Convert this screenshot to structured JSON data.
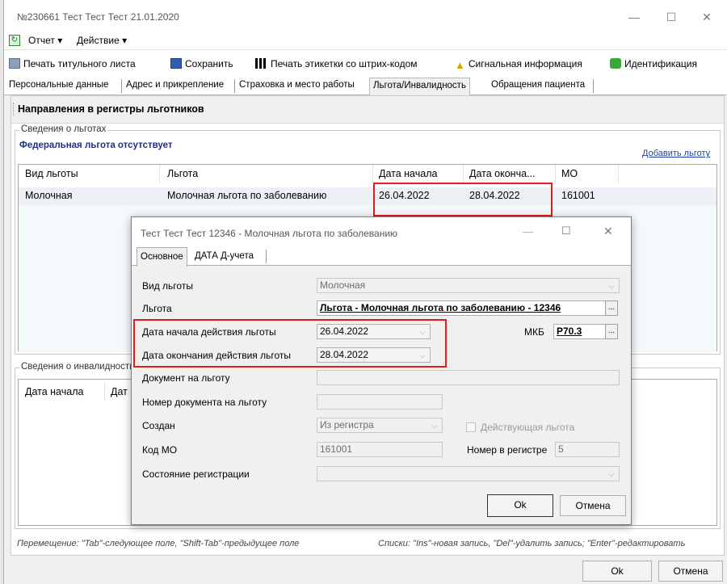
{
  "window": {
    "title": "№230661 Тест Тест Тест 21.01.2020"
  },
  "menu": {
    "items": [
      "Отчет ▾",
      "Действие ▾"
    ]
  },
  "toolbar": {
    "print_title": "Печать титульного листа",
    "save": "Сохранить",
    "print_barcode": "Печать этикетки со штрих-кодом",
    "signal_info": "Сигнальная информация",
    "identification": "Идентификация"
  },
  "tabs": [
    "Персональные данные",
    "Адрес и прикрепление",
    "Страховка и место работы",
    "Льгота/Инвалидность",
    "Обращения пациента"
  ],
  "active_tab_index": 3,
  "section": {
    "title": "Направления в регистры льготников"
  },
  "benefits": {
    "group_label": "Сведения о льготах",
    "federal_status": "Федеральная льгота отсутствует",
    "add_link": "Добавить льготу",
    "columns": [
      "Вид льготы",
      "Льгота",
      "Дата начала",
      "Дата оконча...",
      "МО"
    ],
    "rows": [
      [
        "Молочная",
        "Молочная льгота по заболеванию",
        "26.04.2022",
        "28.04.2022",
        "161001"
      ]
    ]
  },
  "disability": {
    "group_label": "Сведения о инвалидности",
    "columns": [
      "Дата начала",
      "Дат"
    ]
  },
  "status_bar": {
    "left": "Перемещение: \"Tab\"-следующее поле, \"Shift-Tab\"-предыдущее поле",
    "right": "Списки: \"Ins\"-новая запись, \"Del\"-удалить запись; \"Enter\"-редактировать"
  },
  "main_buttons": {
    "ok": "Ok",
    "cancel": "Отмена"
  },
  "dialog": {
    "title": "Тест Тест Тест 12346 - Молочная льгота по заболеванию",
    "tabs": [
      "Основное",
      "ДАТА Д-учета"
    ],
    "fields": {
      "benefit_type_label": "Вид льготы",
      "benefit_type_value": "Молочная",
      "benefit_label": "Льгота",
      "benefit_value": "Льгота - Молочная льгота по заболеванию - 12346",
      "start_label": "Дата начала действия льготы",
      "start_value": "26.04.2022",
      "end_label": "Дата окончания действия льготы",
      "end_value": "28.04.2022",
      "mkb_label": "МКБ",
      "mkb_value": "P70.3",
      "doc_label": "Документ на льготу",
      "doc_value": "",
      "docnum_label": "Номер документа на льготу",
      "docnum_value": "",
      "created_label": "Создан",
      "created_value": "Из регистра",
      "active_label": "Действующая льгота",
      "mo_label": "Код МО",
      "mo_value": "161001",
      "regnum_label": "Номер в регистре",
      "regnum_value": "5",
      "regstate_label": "Состояние регистрации",
      "regstate_value": ""
    },
    "ok": "Ok",
    "cancel": "Отмена"
  },
  "colors": {
    "highlight_red": "#e31b1b",
    "link_blue": "#1a3fa6",
    "federal_text": "#1f2f8f"
  }
}
